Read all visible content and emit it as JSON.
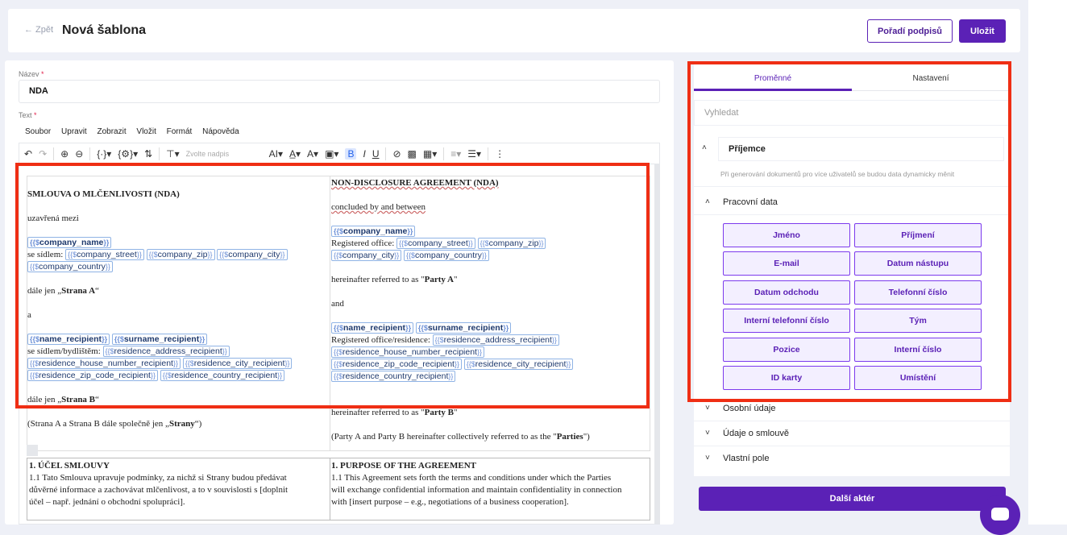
{
  "header": {
    "back_label": "← Zpět",
    "title": "Nová šablona",
    "order_button": "Pořadí podpisů",
    "save_button": "Uložit"
  },
  "form": {
    "name_label": "Název",
    "name_required": "*",
    "name_value": "NDA",
    "text_label": "Text",
    "text_required": "*"
  },
  "menubar": [
    "Soubor",
    "Upravit",
    "Zobrazit",
    "Vložit",
    "Formát",
    "Nápověda"
  ],
  "toolbar": {
    "heading_placeholder": "Zvolte nadpis"
  },
  "document": {
    "left": {
      "title": "SMLOUVA O MLČENLIVOSTI (NDA)",
      "concluded": "uzavřená mezi",
      "seat_label": "se sídlem:",
      "party_a_prefix": "dále jen „",
      "party_a": "Strana A",
      "party_a_suffix": "“",
      "and": "a",
      "residence_label": "se sídlem/bydlištěm:",
      "party_b_prefix": "dále jen „",
      "party_b": "Strana B",
      "party_b_suffix": "“",
      "parties_prefix": "(Strana A a Strana B dále společně jen „",
      "parties": "Strany",
      "parties_suffix": "“)"
    },
    "right": {
      "title": "NON-DISCLOSURE AGREEMENT (NDA)",
      "concluded": "concluded by and between",
      "office_label": "Registered office:",
      "party_a_prefix": "hereinafter referred to as \"",
      "party_a": "Party A",
      "party_a_suffix": "\"",
      "and": "and",
      "office_res_label": "Registered office/residence:",
      "party_b_prefix": "hereinafter referred to as \"",
      "party_b": "Party B",
      "party_b_suffix": "\"",
      "parties_prefix": "(Party A and Party B hereinafter collectively referred to as the \"",
      "parties": "Parties",
      "parties_suffix": "\")"
    },
    "vars": {
      "company_name": "company_name",
      "company_street": "company_street",
      "company_zip": "company_zip",
      "company_city": "company_city",
      "company_country": "company_country",
      "name_recipient": "name_recipient",
      "surname_recipient": "surname_recipient",
      "residence_address_recipient": "residence_address_recipient",
      "residence_house_number_recipient": "residence_house_number_recipient",
      "residence_city_recipient": "residence_city_recipient",
      "residence_zip_code_recipient": "residence_zip_code_recipient",
      "residence_country_recipient": "residence_country_recipient"
    },
    "purpose_left_title": "1. ÚČEL SMLOUVY",
    "purpose_left_1": "1.1 Tato Smlouva upravuje podmínky, za nichž si Strany budou předávat",
    "purpose_left_2": "důvěrné informace a zachovávat mlčenlivost, a to v souvislosti s [doplnit",
    "purpose_left_3": "účel – např. jednání o obchodní spolupráci].",
    "purpose_right_title": "1. PURPOSE OF THE AGREEMENT",
    "purpose_right_1": "1.1 This Agreement sets forth the terms and conditions under which the Parties",
    "purpose_right_2": "will exchange confidential information and maintain confidentiality in connection",
    "purpose_right_3": "with [insert purpose – e.g., negotiations of a business cooperation]."
  },
  "sidebar": {
    "tabs": [
      "Proměnné",
      "Nastavení"
    ],
    "search_placeholder": "Vyhledat",
    "recipient": "Příjemce",
    "hint": "Při generování dokumentů pro více uživatelů se budou data dynamicky měnit",
    "work_data": "Pracovní data",
    "buttons": [
      "Jméno",
      "Příjmení",
      "E-mail",
      "Datum nástupu",
      "Datum odchodu",
      "Telefonní číslo",
      "Interní telefonní číslo",
      "Tým",
      "Pozice",
      "Interní číslo",
      "ID karty",
      "Umístění"
    ],
    "personal": "Osobní údaje",
    "contract": "Údaje o smlouvě",
    "custom": "Vlastní pole",
    "next_actor": "Další aktér"
  },
  "colors": {
    "accent": "#5b21b6",
    "highlight": "#ef2e14"
  }
}
